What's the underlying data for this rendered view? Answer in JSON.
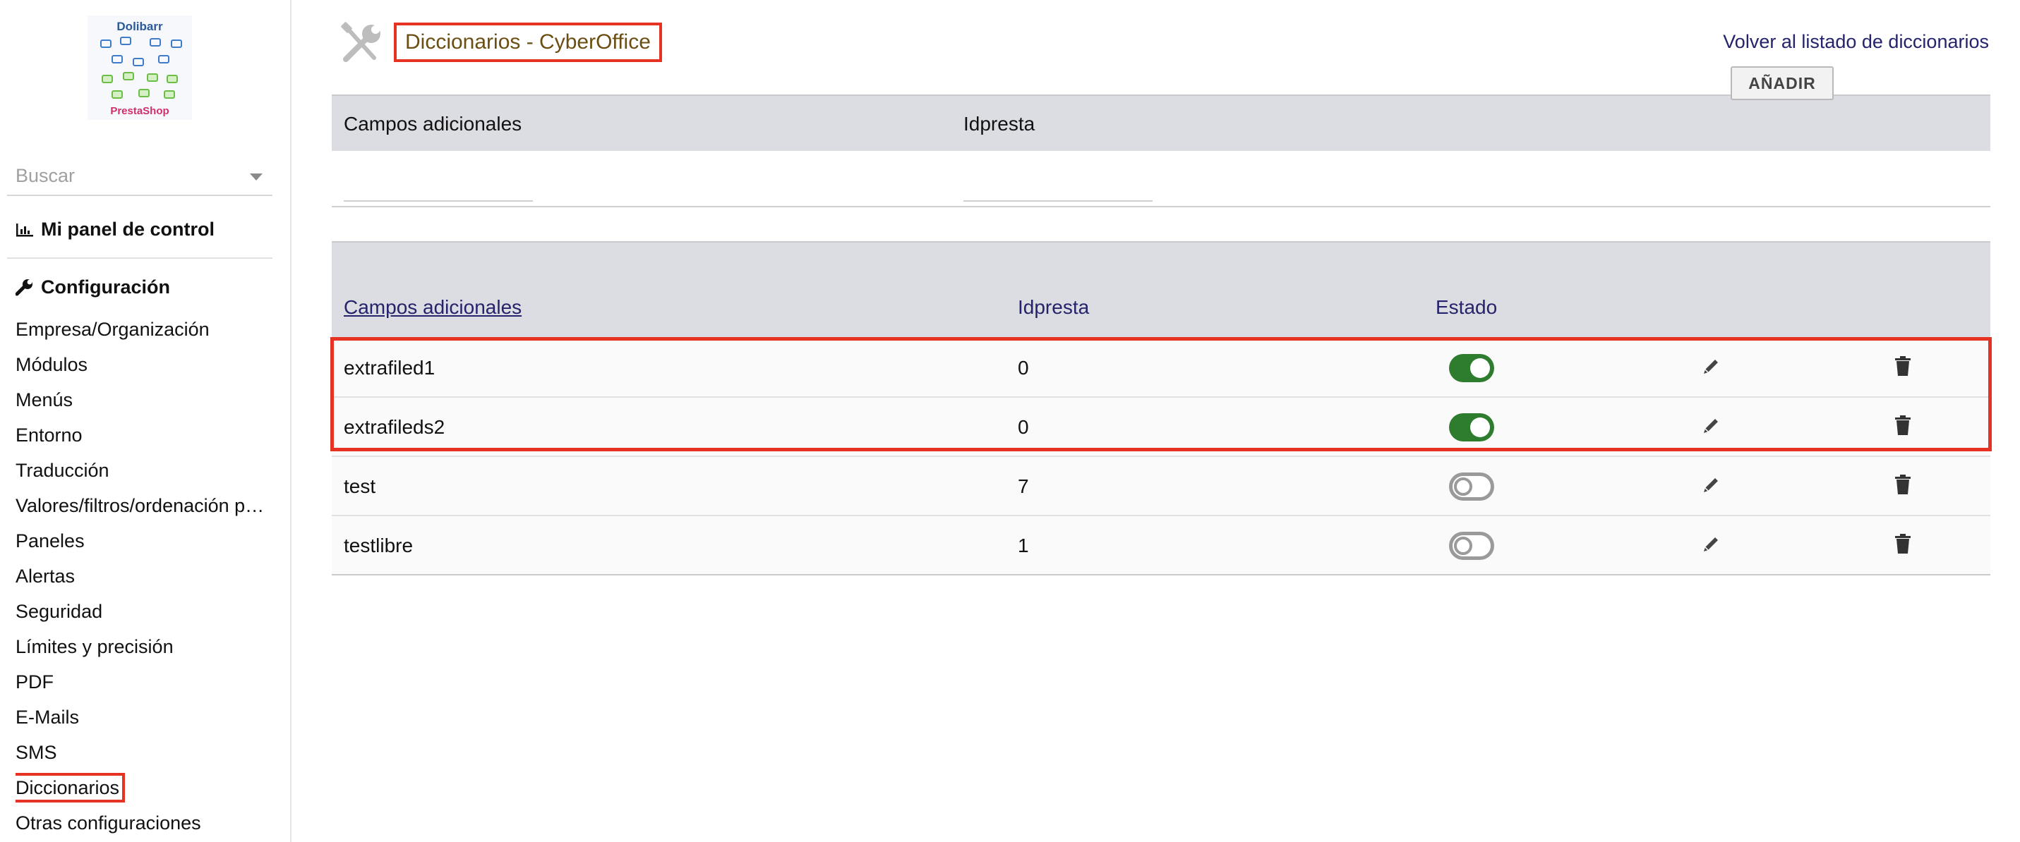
{
  "sidebar": {
    "logo": {
      "top_text": "Dolibarr",
      "bottom_text": "PrestaShop"
    },
    "search_placeholder": "Buscar",
    "dashboard_label": "Mi panel de control",
    "config_label": "Configuración",
    "items": [
      {
        "label": "Empresa/Organización"
      },
      {
        "label": "Módulos"
      },
      {
        "label": "Menús"
      },
      {
        "label": "Entorno"
      },
      {
        "label": "Traducción"
      },
      {
        "label": "Valores/filtros/ordenación p…"
      },
      {
        "label": "Paneles"
      },
      {
        "label": "Alertas"
      },
      {
        "label": "Seguridad"
      },
      {
        "label": "Límites y precisión"
      },
      {
        "label": "PDF"
      },
      {
        "label": "E-Mails"
      },
      {
        "label": "SMS"
      },
      {
        "label": "Diccionarios",
        "active": true
      },
      {
        "label": "Otras configuraciones"
      }
    ]
  },
  "header": {
    "title": "Diccionarios - CyberOffice",
    "back_link": "Volver al listado de diccionarios"
  },
  "add_form": {
    "col1": "Campos adicionales",
    "col2": "Idpresta",
    "add_button": "AÑADIR"
  },
  "list": {
    "headers": {
      "name": "Campos adicionales",
      "id": "Idpresta",
      "status": "Estado"
    },
    "rows": [
      {
        "name": "extrafiled1",
        "id": "0",
        "enabled": true
      },
      {
        "name": "extrafileds2",
        "id": "0",
        "enabled": true
      },
      {
        "name": "test",
        "id": "7",
        "enabled": false
      },
      {
        "name": "testlibre",
        "id": "1",
        "enabled": false
      }
    ]
  },
  "colors": {
    "accent_red": "#e53222",
    "toggle_on": "#2e7d2e",
    "link": "#24236b",
    "header_bg": "#dcdde2"
  }
}
